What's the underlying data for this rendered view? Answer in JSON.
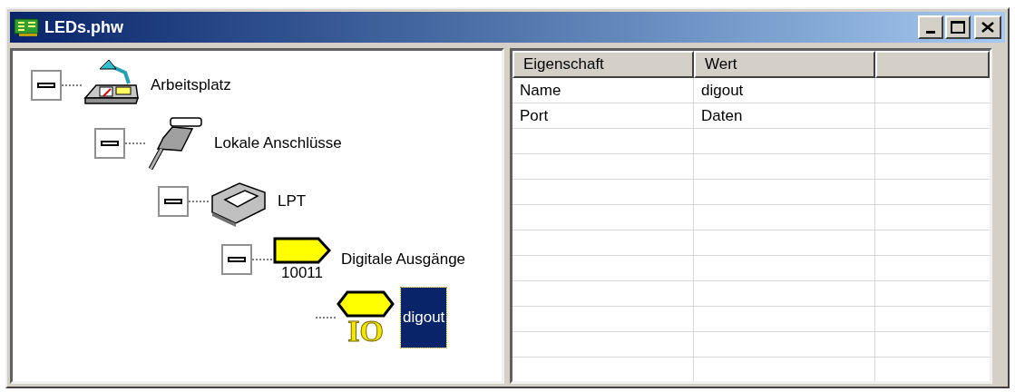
{
  "window": {
    "title": "LEDs.phw"
  },
  "tree": [
    {
      "label": "Arbeitsplatz",
      "expanded": true,
      "selected": false,
      "children": [
        {
          "label": "Lokale Anschlüsse",
          "expanded": true,
          "selected": false,
          "children": [
            {
              "label": "LPT",
              "expanded": true,
              "selected": false,
              "children": [
                {
                  "label": "Digitale Ausgänge",
                  "icon_caption": "10011",
                  "expanded": true,
                  "selected": false,
                  "children": [
                    {
                      "label": "digout",
                      "icon_caption": "IO",
                      "selected": true
                    }
                  ]
                }
              ]
            }
          ]
        }
      ]
    }
  ],
  "table": {
    "columns": [
      "Eigenschaft",
      "Wert"
    ],
    "rows": [
      [
        "Name",
        "digout"
      ],
      [
        "Port",
        "Daten"
      ]
    ]
  }
}
